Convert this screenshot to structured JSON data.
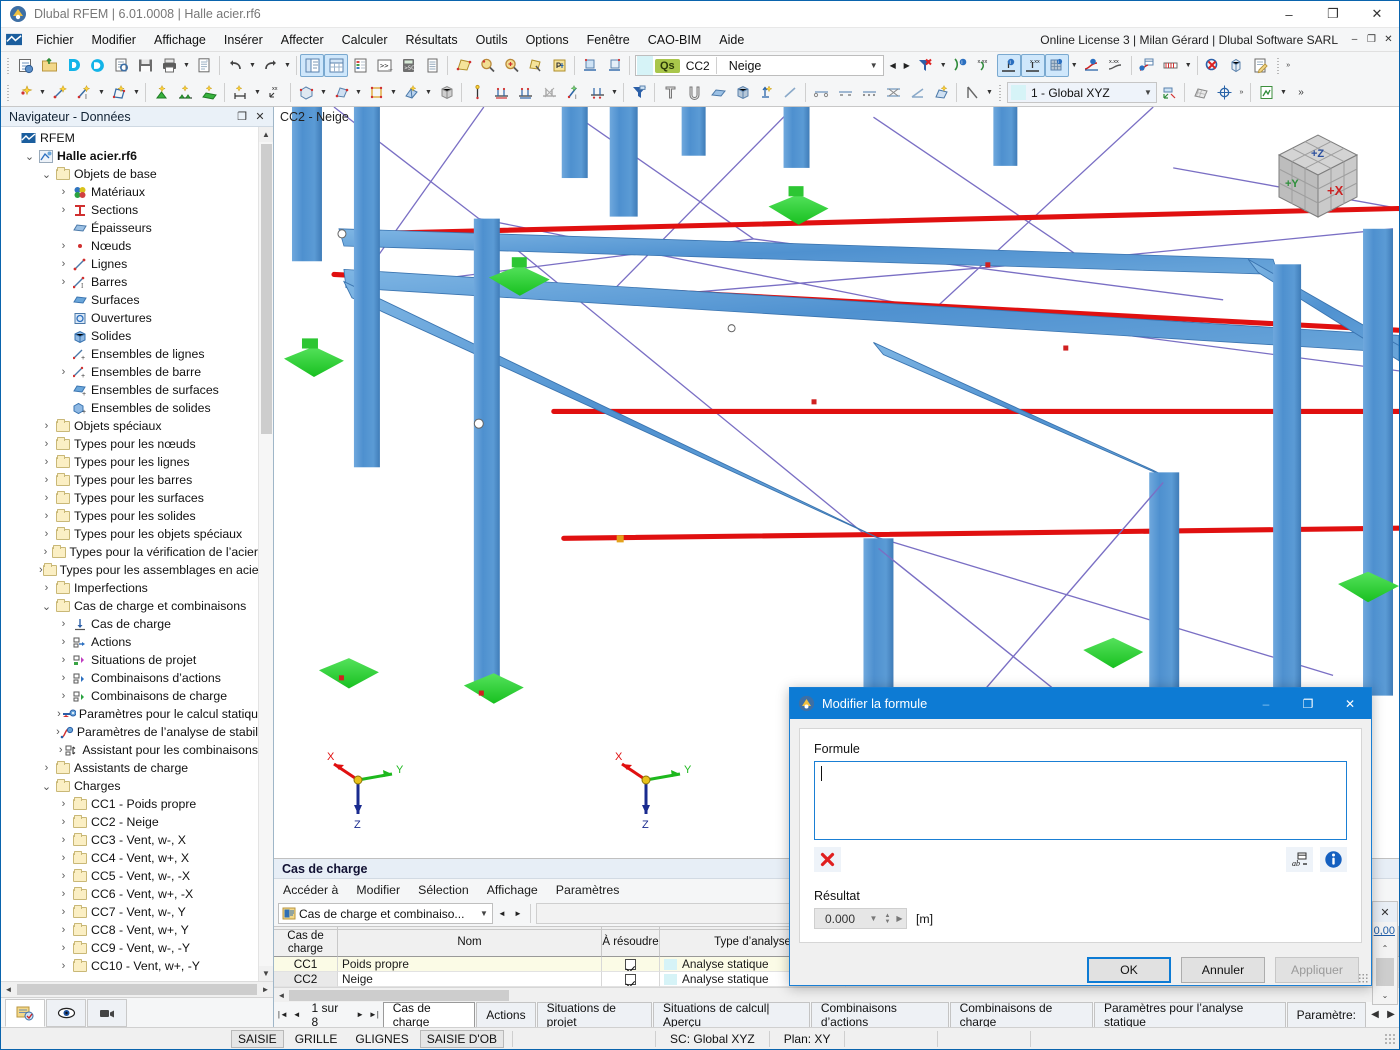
{
  "window": {
    "title": "Dlubal RFEM | 6.01.0008 | Halle acier.rf6",
    "license": "Online License 3 | Milan Gérard | Dlubal Software SARL",
    "minimize": "–",
    "maximize": "❐",
    "close": "✕"
  },
  "menubar": {
    "items": [
      "Fichier",
      "Modifier",
      "Affichage",
      "Insérer",
      "Affecter",
      "Calculer",
      "Résultats",
      "Outils",
      "Options",
      "Fenêtre",
      "CAO-BIM",
      "Aide"
    ],
    "mdi": [
      "–",
      "❐",
      "✕"
    ]
  },
  "toolbar": {
    "loadcase": {
      "qs": "Qs",
      "id": "CC2",
      "name": "Neige"
    },
    "coord_system": "1 - Global XYZ",
    "overflow": "»"
  },
  "navigator": {
    "title": "Navigateur - Données",
    "restore_icon": "❐",
    "close_icon": "✕",
    "tree": [
      {
        "depth": 0,
        "twisty": "",
        "icon": "rfem",
        "label": "RFEM",
        "bold": false
      },
      {
        "depth": 1,
        "twisty": "v",
        "icon": "model",
        "label": "Halle acier.rf6",
        "bold": true
      },
      {
        "depth": 2,
        "twisty": "v",
        "icon": "folder",
        "label": "Objets de base",
        "bold": false
      },
      {
        "depth": 3,
        "twisty": ">",
        "icon": "materials",
        "label": "Matériaux",
        "bold": false
      },
      {
        "depth": 3,
        "twisty": ">",
        "icon": "sections",
        "label": "Sections",
        "bold": false
      },
      {
        "depth": 3,
        "twisty": "",
        "icon": "thickness",
        "label": "Épaisseurs",
        "bold": false
      },
      {
        "depth": 3,
        "twisty": ">",
        "icon": "node",
        "label": "Nœuds",
        "bold": false
      },
      {
        "depth": 3,
        "twisty": ">",
        "icon": "line",
        "label": "Lignes",
        "bold": false
      },
      {
        "depth": 3,
        "twisty": ">",
        "icon": "member",
        "label": "Barres",
        "bold": false
      },
      {
        "depth": 3,
        "twisty": "",
        "icon": "surface",
        "label": "Surfaces",
        "bold": false
      },
      {
        "depth": 3,
        "twisty": "",
        "icon": "opening",
        "label": "Ouvertures",
        "bold": false
      },
      {
        "depth": 3,
        "twisty": "",
        "icon": "solid",
        "label": "Solides",
        "bold": false
      },
      {
        "depth": 3,
        "twisty": "",
        "icon": "lineset",
        "label": "Ensembles de lignes",
        "bold": false
      },
      {
        "depth": 3,
        "twisty": ">",
        "icon": "memberset",
        "label": "Ensembles de barre",
        "bold": false
      },
      {
        "depth": 3,
        "twisty": "",
        "icon": "surfaceset",
        "label": "Ensembles de surfaces",
        "bold": false
      },
      {
        "depth": 3,
        "twisty": "",
        "icon": "solidset",
        "label": "Ensembles de solides",
        "bold": false
      },
      {
        "depth": 2,
        "twisty": ">",
        "icon": "folder",
        "label": "Objets spéciaux",
        "bold": false
      },
      {
        "depth": 2,
        "twisty": ">",
        "icon": "folder",
        "label": "Types pour les nœuds",
        "bold": false
      },
      {
        "depth": 2,
        "twisty": ">",
        "icon": "folder",
        "label": "Types pour les lignes",
        "bold": false
      },
      {
        "depth": 2,
        "twisty": ">",
        "icon": "folder",
        "label": "Types pour les barres",
        "bold": false
      },
      {
        "depth": 2,
        "twisty": ">",
        "icon": "folder",
        "label": "Types pour les surfaces",
        "bold": false
      },
      {
        "depth": 2,
        "twisty": ">",
        "icon": "folder",
        "label": "Types pour les solides",
        "bold": false
      },
      {
        "depth": 2,
        "twisty": ">",
        "icon": "folder",
        "label": "Types pour les objets spéciaux",
        "bold": false
      },
      {
        "depth": 2,
        "twisty": ">",
        "icon": "folder",
        "label": "Types pour la vérification de l’acier",
        "bold": false
      },
      {
        "depth": 2,
        "twisty": ">",
        "icon": "folder",
        "label": "Types pour les assemblages en acier",
        "bold": false
      },
      {
        "depth": 2,
        "twisty": ">",
        "icon": "folder",
        "label": "Imperfections",
        "bold": false
      },
      {
        "depth": 2,
        "twisty": "v",
        "icon": "folder",
        "label": "Cas de charge et combinaisons",
        "bold": false
      },
      {
        "depth": 3,
        "twisty": ">",
        "icon": "loadcase",
        "label": "Cas de charge",
        "bold": false
      },
      {
        "depth": 3,
        "twisty": ">",
        "icon": "action",
        "label": "Actions",
        "bold": false
      },
      {
        "depth": 3,
        "twisty": ">",
        "icon": "designsit",
        "label": "Situations de projet",
        "bold": false
      },
      {
        "depth": 3,
        "twisty": ">",
        "icon": "actcomb",
        "label": "Combinaisons d’actions",
        "bold": false
      },
      {
        "depth": 3,
        "twisty": ">",
        "icon": "loadcomb",
        "label": "Combinaisons de charge",
        "bold": false
      },
      {
        "depth": 3,
        "twisty": ">",
        "icon": "staticparam",
        "label": "Paramètres pour le calcul statiqu",
        "bold": false
      },
      {
        "depth": 3,
        "twisty": ">",
        "icon": "stabparam",
        "label": "Paramètres de l’analyse de stabil",
        "bold": false
      },
      {
        "depth": 3,
        "twisty": ">",
        "icon": "combwiz",
        "label": "Assistant pour les combinaisons",
        "bold": false
      },
      {
        "depth": 2,
        "twisty": ">",
        "icon": "folder",
        "label": "Assistants de charge",
        "bold": false
      },
      {
        "depth": 2,
        "twisty": "v",
        "icon": "folder",
        "label": "Charges",
        "bold": false
      },
      {
        "depth": 3,
        "twisty": ">",
        "icon": "folder",
        "label": "CC1 - Poids propre",
        "bold": false
      },
      {
        "depth": 3,
        "twisty": ">",
        "icon": "folder",
        "label": "CC2 - Neige",
        "bold": false
      },
      {
        "depth": 3,
        "twisty": ">",
        "icon": "folder",
        "label": "CC3 - Vent, w-, X",
        "bold": false
      },
      {
        "depth": 3,
        "twisty": ">",
        "icon": "folder",
        "label": "CC4 - Vent, w+, X",
        "bold": false
      },
      {
        "depth": 3,
        "twisty": ">",
        "icon": "folder",
        "label": "CC5 - Vent, w-, -X",
        "bold": false
      },
      {
        "depth": 3,
        "twisty": ">",
        "icon": "folder",
        "label": "CC6 - Vent, w+, -X",
        "bold": false
      },
      {
        "depth": 3,
        "twisty": ">",
        "icon": "folder",
        "label": "CC7 - Vent, w-, Y",
        "bold": false
      },
      {
        "depth": 3,
        "twisty": ">",
        "icon": "folder",
        "label": "CC8 - Vent, w+, Y",
        "bold": false
      },
      {
        "depth": 3,
        "twisty": ">",
        "icon": "folder",
        "label": "CC9 - Vent, w-, -Y",
        "bold": false
      },
      {
        "depth": 3,
        "twisty": ">",
        "icon": "folder",
        "label": "CC10 - Vent, w+, -Y",
        "bold": false
      }
    ],
    "tabs": [
      "data-navigator-tab",
      "display-navigator-tab",
      "views-navigator-tab"
    ]
  },
  "viewport": {
    "label": "CC2 - Neige",
    "axes": {
      "x": "X",
      "y": "Y",
      "z": "Z"
    },
    "nav_cube": {
      "front": "+X",
      "left": "+Y",
      "top": "+Z"
    }
  },
  "table_panel": {
    "title": "Cas de charge",
    "menu": [
      "Accéder à",
      "Modifier",
      "Sélection",
      "Affichage",
      "Paramètres"
    ],
    "selector": "Cas de charge et combinaiso...",
    "prev": "◄",
    "next": "►",
    "columns": [
      "Cas de charge",
      "Nom",
      "À résoudre",
      "Type d’analyse"
    ],
    "rows": [
      {
        "id": "CC1",
        "name": "Poids propre",
        "solve": true,
        "analysis": "Analyse statique"
      },
      {
        "id": "CC2",
        "name": "Neige",
        "solve": true,
        "analysis": "Analyse statique"
      }
    ],
    "pager": {
      "first": "|◄",
      "prev": "◄",
      "text": "1 sur 8",
      "next": "►",
      "last": "►|"
    },
    "tabs": [
      {
        "label": "Cas de charge",
        "selected": true
      },
      {
        "label": "Actions",
        "selected": false
      },
      {
        "label": "Situations de projet",
        "selected": false
      },
      {
        "label": "Situations de calcul| Aperçu",
        "selected": false
      },
      {
        "label": "Combinaisons d’actions",
        "selected": false
      },
      {
        "label": "Combinaisons de charge",
        "selected": false
      },
      {
        "label": "Paramètres pour l’analyse statique",
        "selected": false
      },
      {
        "label": "Paramètre:",
        "selected": false
      }
    ]
  },
  "right_strip": {
    "close": "✕",
    "value": "0,00",
    "up": "⌃",
    "down": "⌄"
  },
  "statusbar": {
    "buttons": [
      {
        "label": "SAISIE",
        "on": true
      },
      {
        "label": "GRILLE",
        "on": false
      },
      {
        "label": "GLIGNES",
        "on": false
      },
      {
        "label": "SAISIE D'OB",
        "on": true
      }
    ],
    "coord_system": "SC: Global XYZ",
    "plane": "Plan: XY"
  },
  "dialog": {
    "title": "Modifier la formule",
    "minimize": "–",
    "maximize": "❐",
    "close": "✕",
    "formula_label": "Formule",
    "formula_value": "",
    "result_label": "Résultat",
    "result_value": "0.000",
    "result_unit": "[m]",
    "buttons": {
      "ok": "OK",
      "cancel": "Annuler",
      "apply": "Appliquer"
    }
  }
}
